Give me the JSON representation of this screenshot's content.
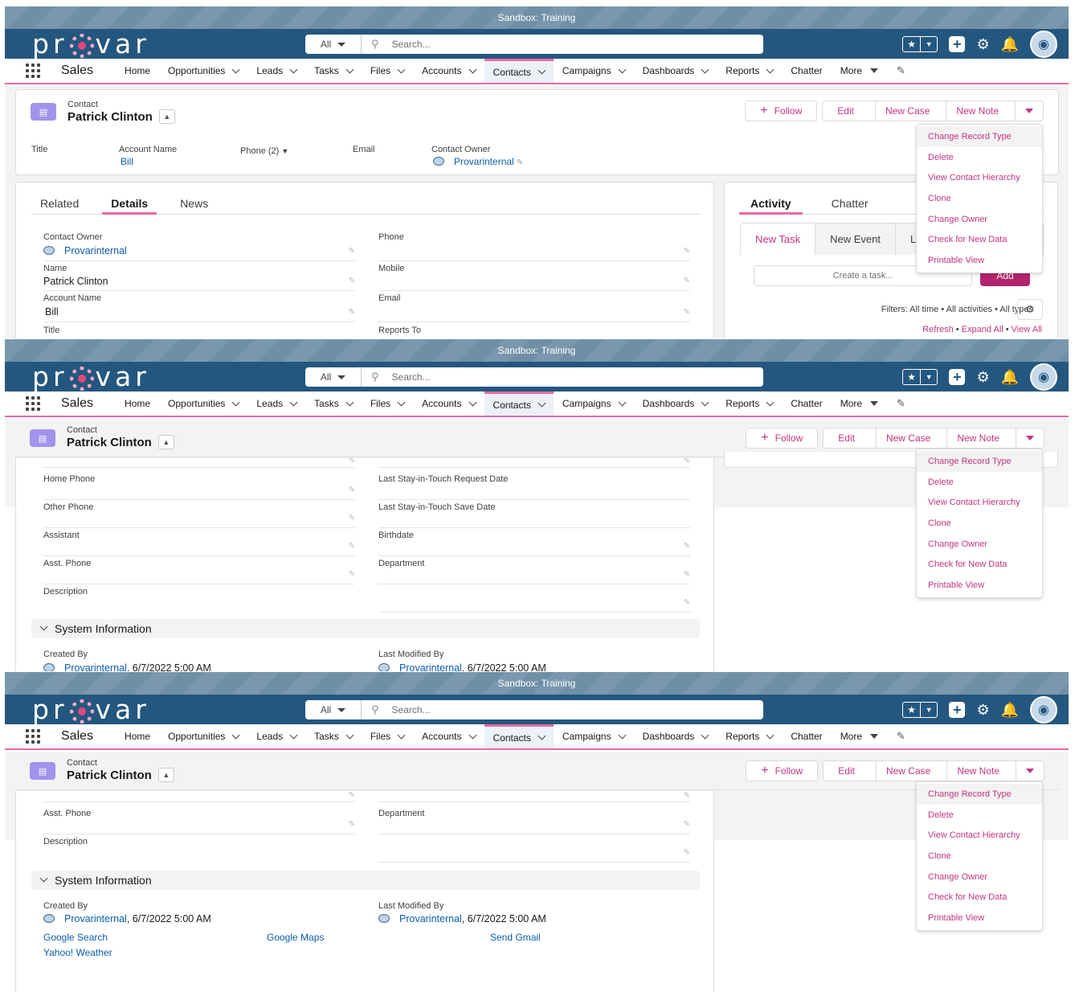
{
  "sandbox": "Sandbox: Training",
  "header": {
    "logo_left": "pr",
    "logo_right": "var",
    "scope": "All",
    "search_placeholder": "Search..."
  },
  "nav": {
    "app": "Sales",
    "items": [
      "Home",
      "Opportunities",
      "Leads",
      "Tasks",
      "Files",
      "Accounts",
      "Contacts",
      "Campaigns",
      "Dashboards",
      "Reports",
      "Chatter",
      "More"
    ]
  },
  "record": {
    "object_label": "Contact",
    "name": "Patrick Clinton",
    "buttons": {
      "follow": "Follow",
      "edit": "Edit",
      "new_case": "New Case",
      "new_note": "New Note"
    },
    "menu": [
      "Change Record Type",
      "Delete",
      "View Contact Hierarchy",
      "Clone",
      "Change Owner",
      "Check for New Data",
      "Printable View"
    ]
  },
  "highlights": {
    "title_label": "Title",
    "account_label": "Account Name",
    "account_value": "Bill",
    "phone_label": "Phone (2)",
    "email_label": "Email",
    "owner_label": "Contact Owner",
    "owner_value": "Provarinternal"
  },
  "tabs": [
    "Related",
    "Details",
    "News"
  ],
  "details": {
    "contact_owner_label": "Contact Owner",
    "contact_owner_value": "Provarinternal",
    "phone_label": "Phone",
    "name_label": "Name",
    "name_value": "Patrick Clinton",
    "mobile_label": "Mobile",
    "account_label": "Account Name",
    "account_value": "Bill",
    "email_label": "Email",
    "title_label": "Title",
    "reports_to_label": "Reports To",
    "home_phone_label": "Home Phone",
    "last_stay_request_label": "Last Stay-in-Touch Request Date",
    "other_phone_label": "Other Phone",
    "last_stay_save_label": "Last Stay-in-Touch Save Date",
    "assistant_label": "Assistant",
    "birthdate_label": "Birthdate",
    "asst_phone_label": "Asst. Phone",
    "department_label": "Department",
    "description_label": "Description",
    "system_info": "System Information",
    "created_by_label": "Created By",
    "created_by_user": "Provarinternal",
    "created_by_date": ", 6/7/2022 5:00 AM",
    "modified_by_label": "Last Modified By",
    "modified_by_user": "Provarinternal",
    "modified_by_date": ", 6/7/2022 5:00 AM"
  },
  "custom_links": [
    "Google Search",
    "Google Maps",
    "Send Gmail",
    "Yahoo! Weather"
  ],
  "activity": {
    "tabs": [
      "Activity",
      "Chatter"
    ],
    "composer_tabs": [
      "New Task",
      "New Event",
      "L"
    ],
    "task_placeholder": "Create a task...",
    "add": "Add",
    "filters": "Filters: All time • All activities • All types",
    "refresh": "Refresh",
    "expand_all": "Expand All",
    "view_all": "View All",
    "sep": " • "
  },
  "colors": {
    "brand": "#24577f",
    "accent": "#e86aa6",
    "link": "#0b5cab",
    "action": "#c23582"
  }
}
